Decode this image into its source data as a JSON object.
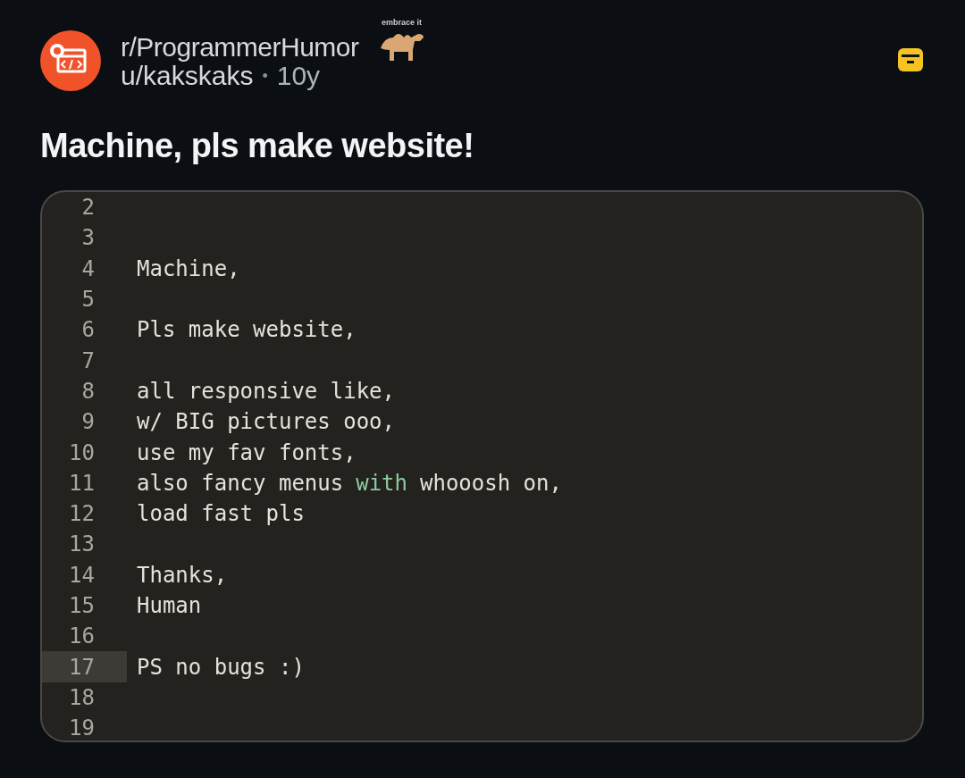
{
  "post": {
    "subreddit": "r/ProgrammerHumor",
    "flair_caption": "embrace it",
    "author": "u/kakskaks",
    "separator": "•",
    "age": "10y",
    "title": "Machine, pls make website!"
  },
  "editor": {
    "lines": [
      {
        "number": "2",
        "selected": false
      },
      {
        "number": "3",
        "selected": false
      },
      {
        "number": "4",
        "selected": false,
        "segments": [
          {
            "text": "Machine,",
            "kind": "plain"
          }
        ]
      },
      {
        "number": "5",
        "selected": false
      },
      {
        "number": "6",
        "selected": false,
        "segments": [
          {
            "text": "Pls make website,",
            "kind": "plain"
          }
        ]
      },
      {
        "number": "7",
        "selected": false
      },
      {
        "number": "8",
        "selected": false,
        "segments": [
          {
            "text": "all responsive like,",
            "kind": "plain"
          }
        ]
      },
      {
        "number": "9",
        "selected": false,
        "segments": [
          {
            "text": "w/ BIG pictures ooo,",
            "kind": "plain"
          }
        ]
      },
      {
        "number": "10",
        "selected": false,
        "segments": [
          {
            "text": "use my fav fonts,",
            "kind": "plain"
          }
        ]
      },
      {
        "number": "11",
        "selected": false,
        "segments": [
          {
            "text": "also fancy menus",
            "kind": "plain"
          },
          {
            "text": "with",
            "kind": "keyword"
          },
          {
            "text": "whooosh on,",
            "kind": "plain"
          }
        ]
      },
      {
        "number": "12",
        "selected": false,
        "segments": [
          {
            "text": "load fast pls",
            "kind": "plain"
          }
        ]
      },
      {
        "number": "13",
        "selected": false
      },
      {
        "number": "14",
        "selected": false,
        "segments": [
          {
            "text": "Thanks,",
            "kind": "plain"
          }
        ]
      },
      {
        "number": "15",
        "selected": false,
        "segments": [
          {
            "text": "Human",
            "kind": "plain"
          }
        ]
      },
      {
        "number": "16",
        "selected": false
      },
      {
        "number": "17",
        "selected": true,
        "segments": [
          {
            "text": "PS no bugs :)",
            "kind": "plain"
          }
        ]
      },
      {
        "number": "18",
        "selected": false
      },
      {
        "number": "19",
        "selected": false
      }
    ]
  }
}
